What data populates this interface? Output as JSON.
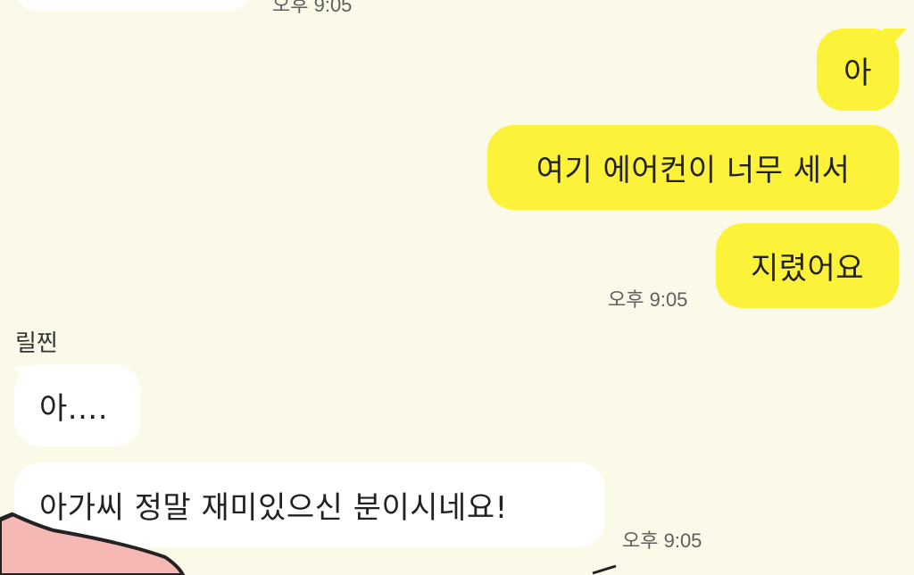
{
  "chat": {
    "top_partial": {
      "time": "오후 9:05"
    },
    "sent": {
      "messages": [
        {
          "text": "아"
        },
        {
          "text": "여기 에어컨이 너무 세서"
        },
        {
          "text": "지렸어요"
        }
      ],
      "time": "오후 9:05"
    },
    "received": {
      "sender": "릴찐",
      "messages": [
        {
          "text": "아...."
        },
        {
          "text": "아가씨 정말 재미있으신 분이시네요!"
        }
      ],
      "time": "오후 9:05"
    }
  },
  "colors": {
    "background": "#fbf9e8",
    "sent_bubble": "#fdf23a",
    "received_bubble": "#ffffff",
    "decor_pink": "#f6b8b4"
  }
}
